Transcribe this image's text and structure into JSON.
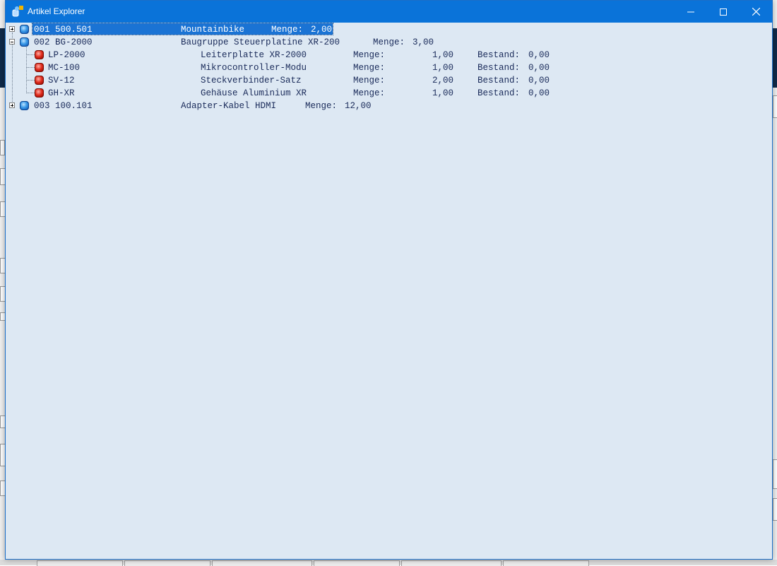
{
  "window": {
    "title": "Artikel Explorer"
  },
  "controls": {
    "minimize": "minimize",
    "maximize": "maximize",
    "close": "close"
  },
  "tree": [
    {
      "id": "001 500.501",
      "name": "Mountainbike",
      "menge_label": "Menge:",
      "menge": "2,00",
      "expanded": false,
      "selected": true,
      "children": []
    },
    {
      "id": "002 BG-2000",
      "name": "Baugruppe Steuerplatine XR-200",
      "menge_label": "Menge:",
      "menge": "3,00",
      "expanded": true,
      "selected": false,
      "children": [
        {
          "id": "LP-2000",
          "name": "Leiterplatte XR-2000",
          "menge_label": "Menge:",
          "menge": "1,00",
          "bestand_label": "Bestand:",
          "bestand": "0,00"
        },
        {
          "id": "MC-100",
          "name": "Mikrocontroller-Modu",
          "menge_label": "Menge:",
          "menge": "1,00",
          "bestand_label": "Bestand:",
          "bestand": "0,00"
        },
        {
          "id": "SV-12",
          "name": "Steckverbinder-Satz",
          "menge_label": "Menge:",
          "menge": "2,00",
          "bestand_label": "Bestand:",
          "bestand": "0,00"
        },
        {
          "id": "GH-XR",
          "name": "Gehäuse Aluminium XR",
          "menge_label": "Menge:",
          "menge": "1,00",
          "bestand_label": "Bestand:",
          "bestand": "0,00"
        }
      ]
    },
    {
      "id": "003 100.101",
      "name": "Adapter-Kabel HDMI",
      "menge_label": "Menge:",
      "menge": "12,00",
      "expanded": false,
      "selected": false,
      "children": []
    }
  ],
  "colors": {
    "titlebar": "#0a73d9",
    "content_bg": "#dde8f3",
    "text": "#1a2b5a",
    "selection": "#1a73d4",
    "node_blue": "#3c9be8",
    "node_red": "#e02b1c"
  },
  "icons": {
    "app": "app-icon",
    "assembly_node": "blue-node-icon",
    "part_node": "red-node-icon"
  }
}
